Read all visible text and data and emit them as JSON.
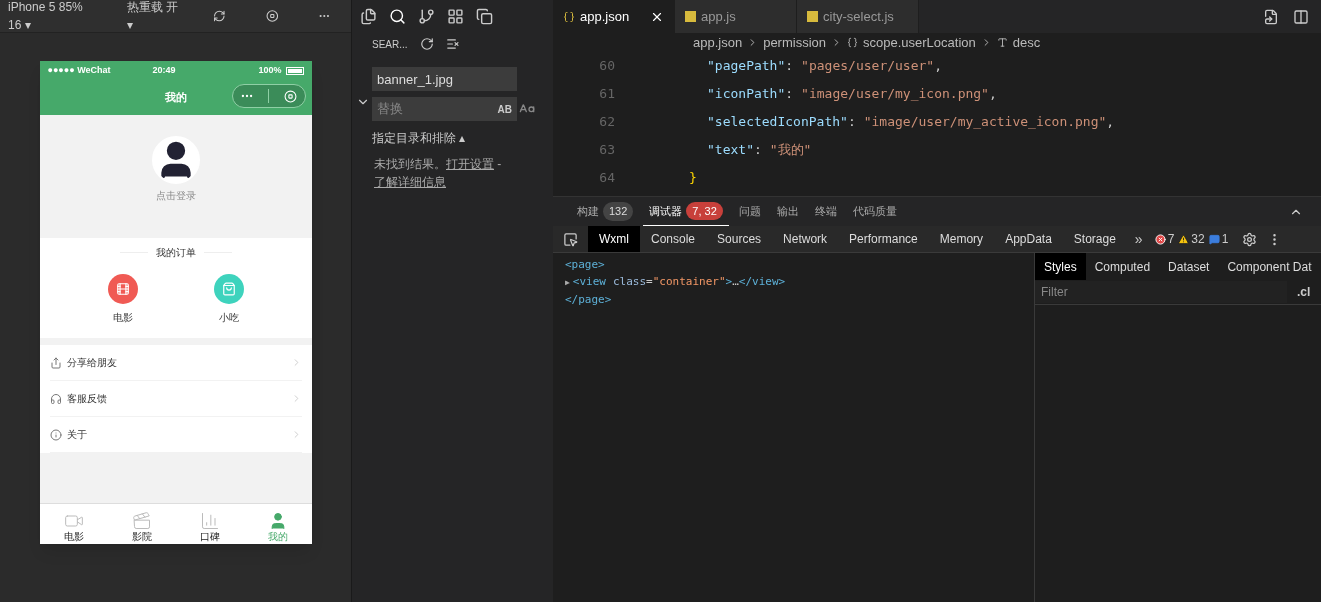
{
  "simulator_toolbar": {
    "device": "iPhone 5 85% 16 ▾",
    "hot_reload": "热重载 开 ▾"
  },
  "phone": {
    "status_bar": {
      "carrier": "●●●●● WeChat",
      "time": "20:49",
      "battery": "100%"
    },
    "nav_title": "我的",
    "login": "点击登录",
    "orders_title": "我的订单",
    "orders": [
      {
        "kind": "film",
        "label": "电影",
        "color": "#f05a54"
      },
      {
        "kind": "snack",
        "label": "小吃",
        "color": "#3ed3bd"
      }
    ],
    "menu": [
      {
        "kind": "share",
        "label": "分享给朋友"
      },
      {
        "kind": "service",
        "label": "客服反馈"
      },
      {
        "kind": "about",
        "label": "关于"
      }
    ],
    "tab_bar": [
      {
        "kind": "film",
        "label": "电影",
        "selected": false
      },
      {
        "kind": "cinema",
        "label": "影院",
        "selected": false
      },
      {
        "kind": "rank",
        "label": "口碑",
        "selected": false
      },
      {
        "kind": "me",
        "label": "我的",
        "selected": true
      }
    ]
  },
  "search_panel": {
    "title": "SEAR...",
    "query": "banner_1.jpg",
    "replace_placeholder": "替换",
    "replace_button": "AB",
    "include_exclude": "指定目录和排除 ▴",
    "no_results": "未找到结果。",
    "open_settings": "打开设置",
    "separator": " -",
    "learn_more": "了解详细信息"
  },
  "editor": {
    "tabs": [
      {
        "label": "app.json",
        "selected": true,
        "kind": "json"
      },
      {
        "label": "app.js",
        "selected": false,
        "kind": "js"
      },
      {
        "label": "city-select.js",
        "selected": false,
        "kind": "js"
      }
    ],
    "breadcrumb": [
      "app.json",
      "permission",
      "scope.userLocation",
      "desc"
    ],
    "lines": [
      {
        "number": "60",
        "kind": "property",
        "tokens": [
          {
            "kind": "key",
            "text": "\"pagePath\""
          },
          {
            "kind": "punct",
            "text": ":"
          },
          {
            "kind": "string",
            "text": "\"pages/user/user\""
          },
          {
            "kind": "punct",
            "text": ","
          }
        ]
      },
      {
        "number": "61",
        "kind": "property",
        "tokens": [
          {
            "kind": "key",
            "text": "\"iconPath\""
          },
          {
            "kind": "punct",
            "text": ":"
          },
          {
            "kind": "string",
            "text": "\"image/user/my_icon.png\""
          },
          {
            "kind": "punct",
            "text": ","
          }
        ]
      },
      {
        "number": "62",
        "kind": "property",
        "tokens": [
          {
            "kind": "key",
            "text": "\"selectedIconPath\""
          },
          {
            "kind": "punct",
            "text": ":"
          },
          {
            "kind": "string",
            "text": "\"image/user/my_active_icon.png\""
          },
          {
            "kind": "punct",
            "text": ","
          }
        ]
      },
      {
        "number": "63",
        "kind": "property",
        "tokens": [
          {
            "kind": "key",
            "text": "\"text\""
          },
          {
            "kind": "punct",
            "text": ":"
          },
          {
            "kind": "string",
            "text": "\"我的\""
          }
        ]
      },
      {
        "number": "64",
        "kind": "close",
        "text": "}"
      }
    ]
  },
  "panel_tabs": [
    {
      "label": "构建",
      "badge": "132",
      "selected": false,
      "kind": "count"
    },
    {
      "label": "调试器",
      "badge": "7, 32",
      "selected": true,
      "kind": "alert"
    },
    {
      "label": "问题",
      "selected": false,
      "kind": "plain"
    },
    {
      "label": "输出",
      "selected": false,
      "kind": "plain"
    },
    {
      "label": "终端",
      "selected": false,
      "kind": "plain"
    },
    {
      "label": "代码质量",
      "selected": false,
      "kind": "plain"
    }
  ],
  "devtools": {
    "tabs": [
      {
        "label": "Wxml",
        "selected": true
      },
      {
        "label": "Console",
        "selected": false
      },
      {
        "label": "Sources",
        "selected": false
      },
      {
        "label": "Network",
        "selected": false
      },
      {
        "label": "Performance",
        "selected": false
      },
      {
        "label": "Memory",
        "selected": false
      },
      {
        "label": "AppData",
        "selected": false
      },
      {
        "label": "Storage",
        "selected": false
      }
    ],
    "more": "»",
    "errors": "7",
    "warnings": "32",
    "infos": "1",
    "tree": [
      {
        "kind": "open",
        "text": "<page>"
      },
      {
        "kind": "node",
        "tokens": [
          {
            "kind": "arrow",
            "text": "▶"
          },
          {
            "kind": "tag",
            "text": "<view"
          },
          {
            "kind": "attr",
            "text": "class"
          },
          {
            "kind": "punct",
            "text": "="
          },
          {
            "kind": "value",
            "text": "\"container\""
          },
          {
            "kind": "tag",
            "text": ">"
          },
          {
            "kind": "plain",
            "text": "…"
          },
          {
            "kind": "tag",
            "text": "</view>"
          }
        ]
      },
      {
        "kind": "open",
        "text": "</page>"
      }
    ],
    "styles_tabs": [
      {
        "label": "Styles",
        "selected": true
      },
      {
        "label": "Computed",
        "selected": false
      },
      {
        "label": "Dataset",
        "selected": false
      },
      {
        "label": "Component Dat",
        "selected": false
      }
    ],
    "filter_placeholder": "Filter",
    "cls": ".cl"
  }
}
